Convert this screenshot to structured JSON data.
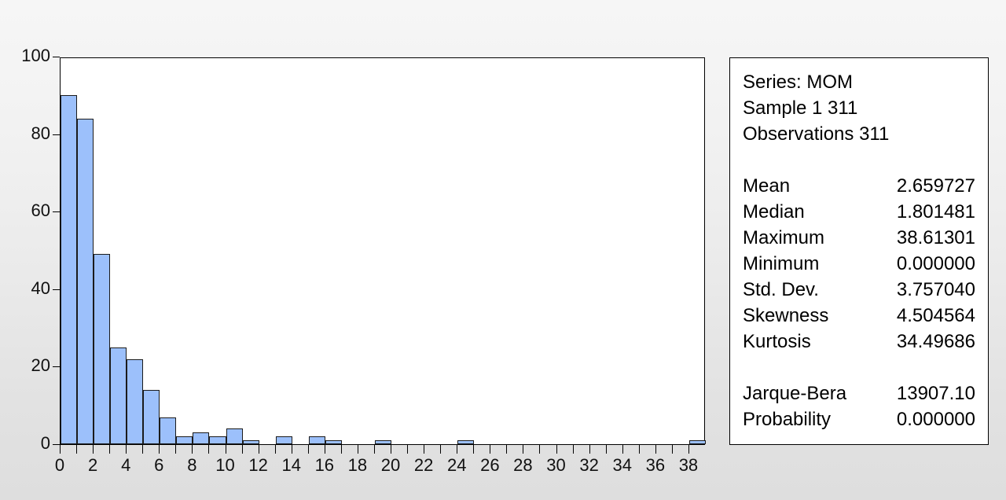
{
  "stats_panel": {
    "series_line": "Series: MOM",
    "sample_line": "Sample 1 311",
    "observations_line": "Observations 311",
    "rows": [
      {
        "label": "Mean",
        "value": "2.659727"
      },
      {
        "label": "Median",
        "value": "1.801481"
      },
      {
        "label": "Maximum",
        "value": "38.61301"
      },
      {
        "label": "Minimum",
        "value": "0.000000"
      },
      {
        "label": "Std. Dev.",
        "value": "3.757040"
      },
      {
        "label": "Skewness",
        "value": "4.504564"
      },
      {
        "label": "Kurtosis",
        "value": "34.49686"
      }
    ],
    "test_rows": [
      {
        "label": "Jarque-Bera",
        "value": "13907.10"
      },
      {
        "label": "Probability",
        "value": "0.000000"
      }
    ]
  },
  "colors": {
    "bar_fill": "#9cc0fb",
    "bar_border": "#1b1b1b",
    "plot_background": "#ffffff",
    "page_background": "#efefef",
    "axis": "#000000",
    "text": "#111111"
  },
  "chart_data": {
    "type": "bar",
    "title": "",
    "subtitle": "",
    "xlabel": "",
    "ylabel": "",
    "grid": false,
    "legend": "none",
    "xlim": [
      0,
      39
    ],
    "ylim": [
      0,
      100
    ],
    "y_ticks": [
      0,
      20,
      40,
      60,
      80,
      100
    ],
    "x_ticks": [
      0,
      2,
      4,
      6,
      8,
      10,
      12,
      14,
      16,
      18,
      20,
      22,
      24,
      26,
      28,
      30,
      32,
      34,
      36,
      38
    ],
    "x_minor_ticks": [
      1,
      3,
      5,
      7,
      9,
      11,
      13,
      15,
      17,
      19,
      21,
      23,
      25,
      27,
      29,
      31,
      33,
      35,
      37
    ],
    "bin_width": 1,
    "categories": [
      "0-1",
      "1-2",
      "2-3",
      "3-4",
      "4-5",
      "5-6",
      "6-7",
      "7-8",
      "8-9",
      "9-10",
      "10-11",
      "11-12",
      "12-13",
      "13-14",
      "14-15",
      "15-16",
      "16-17",
      "17-18",
      "18-19",
      "19-20",
      "20-21",
      "21-22",
      "22-23",
      "23-24",
      "24-25",
      "25-26",
      "26-27",
      "27-28",
      "28-29",
      "29-30",
      "30-31",
      "31-32",
      "32-33",
      "33-34",
      "34-35",
      "35-36",
      "36-37",
      "37-38",
      "38-39"
    ],
    "bins": [
      {
        "x0": 0,
        "x1": 1,
        "count": 90
      },
      {
        "x0": 1,
        "x1": 2,
        "count": 84
      },
      {
        "x0": 2,
        "x1": 3,
        "count": 49
      },
      {
        "x0": 3,
        "x1": 4,
        "count": 25
      },
      {
        "x0": 4,
        "x1": 5,
        "count": 22
      },
      {
        "x0": 5,
        "x1": 6,
        "count": 14
      },
      {
        "x0": 6,
        "x1": 7,
        "count": 7
      },
      {
        "x0": 7,
        "x1": 8,
        "count": 2
      },
      {
        "x0": 8,
        "x1": 9,
        "count": 3
      },
      {
        "x0": 9,
        "x1": 10,
        "count": 2
      },
      {
        "x0": 10,
        "x1": 11,
        "count": 4
      },
      {
        "x0": 11,
        "x1": 12,
        "count": 1
      },
      {
        "x0": 12,
        "x1": 13,
        "count": 0
      },
      {
        "x0": 13,
        "x1": 14,
        "count": 2
      },
      {
        "x0": 14,
        "x1": 15,
        "count": 0
      },
      {
        "x0": 15,
        "x1": 16,
        "count": 2
      },
      {
        "x0": 16,
        "x1": 17,
        "count": 1
      },
      {
        "x0": 17,
        "x1": 18,
        "count": 0
      },
      {
        "x0": 18,
        "x1": 19,
        "count": 0
      },
      {
        "x0": 19,
        "x1": 20,
        "count": 1
      },
      {
        "x0": 20,
        "x1": 21,
        "count": 0
      },
      {
        "x0": 21,
        "x1": 22,
        "count": 0
      },
      {
        "x0": 22,
        "x1": 23,
        "count": 0
      },
      {
        "x0": 23,
        "x1": 24,
        "count": 0
      },
      {
        "x0": 24,
        "x1": 25,
        "count": 1
      },
      {
        "x0": 25,
        "x1": 26,
        "count": 0
      },
      {
        "x0": 26,
        "x1": 27,
        "count": 0
      },
      {
        "x0": 27,
        "x1": 28,
        "count": 0
      },
      {
        "x0": 28,
        "x1": 29,
        "count": 0
      },
      {
        "x0": 29,
        "x1": 30,
        "count": 0
      },
      {
        "x0": 30,
        "x1": 31,
        "count": 0
      },
      {
        "x0": 31,
        "x1": 32,
        "count": 0
      },
      {
        "x0": 32,
        "x1": 33,
        "count": 0
      },
      {
        "x0": 33,
        "x1": 34,
        "count": 0
      },
      {
        "x0": 34,
        "x1": 35,
        "count": 0
      },
      {
        "x0": 35,
        "x1": 36,
        "count": 0
      },
      {
        "x0": 36,
        "x1": 37,
        "count": 0
      },
      {
        "x0": 37,
        "x1": 38,
        "count": 0
      },
      {
        "x0": 38,
        "x1": 39,
        "count": 1
      }
    ]
  }
}
